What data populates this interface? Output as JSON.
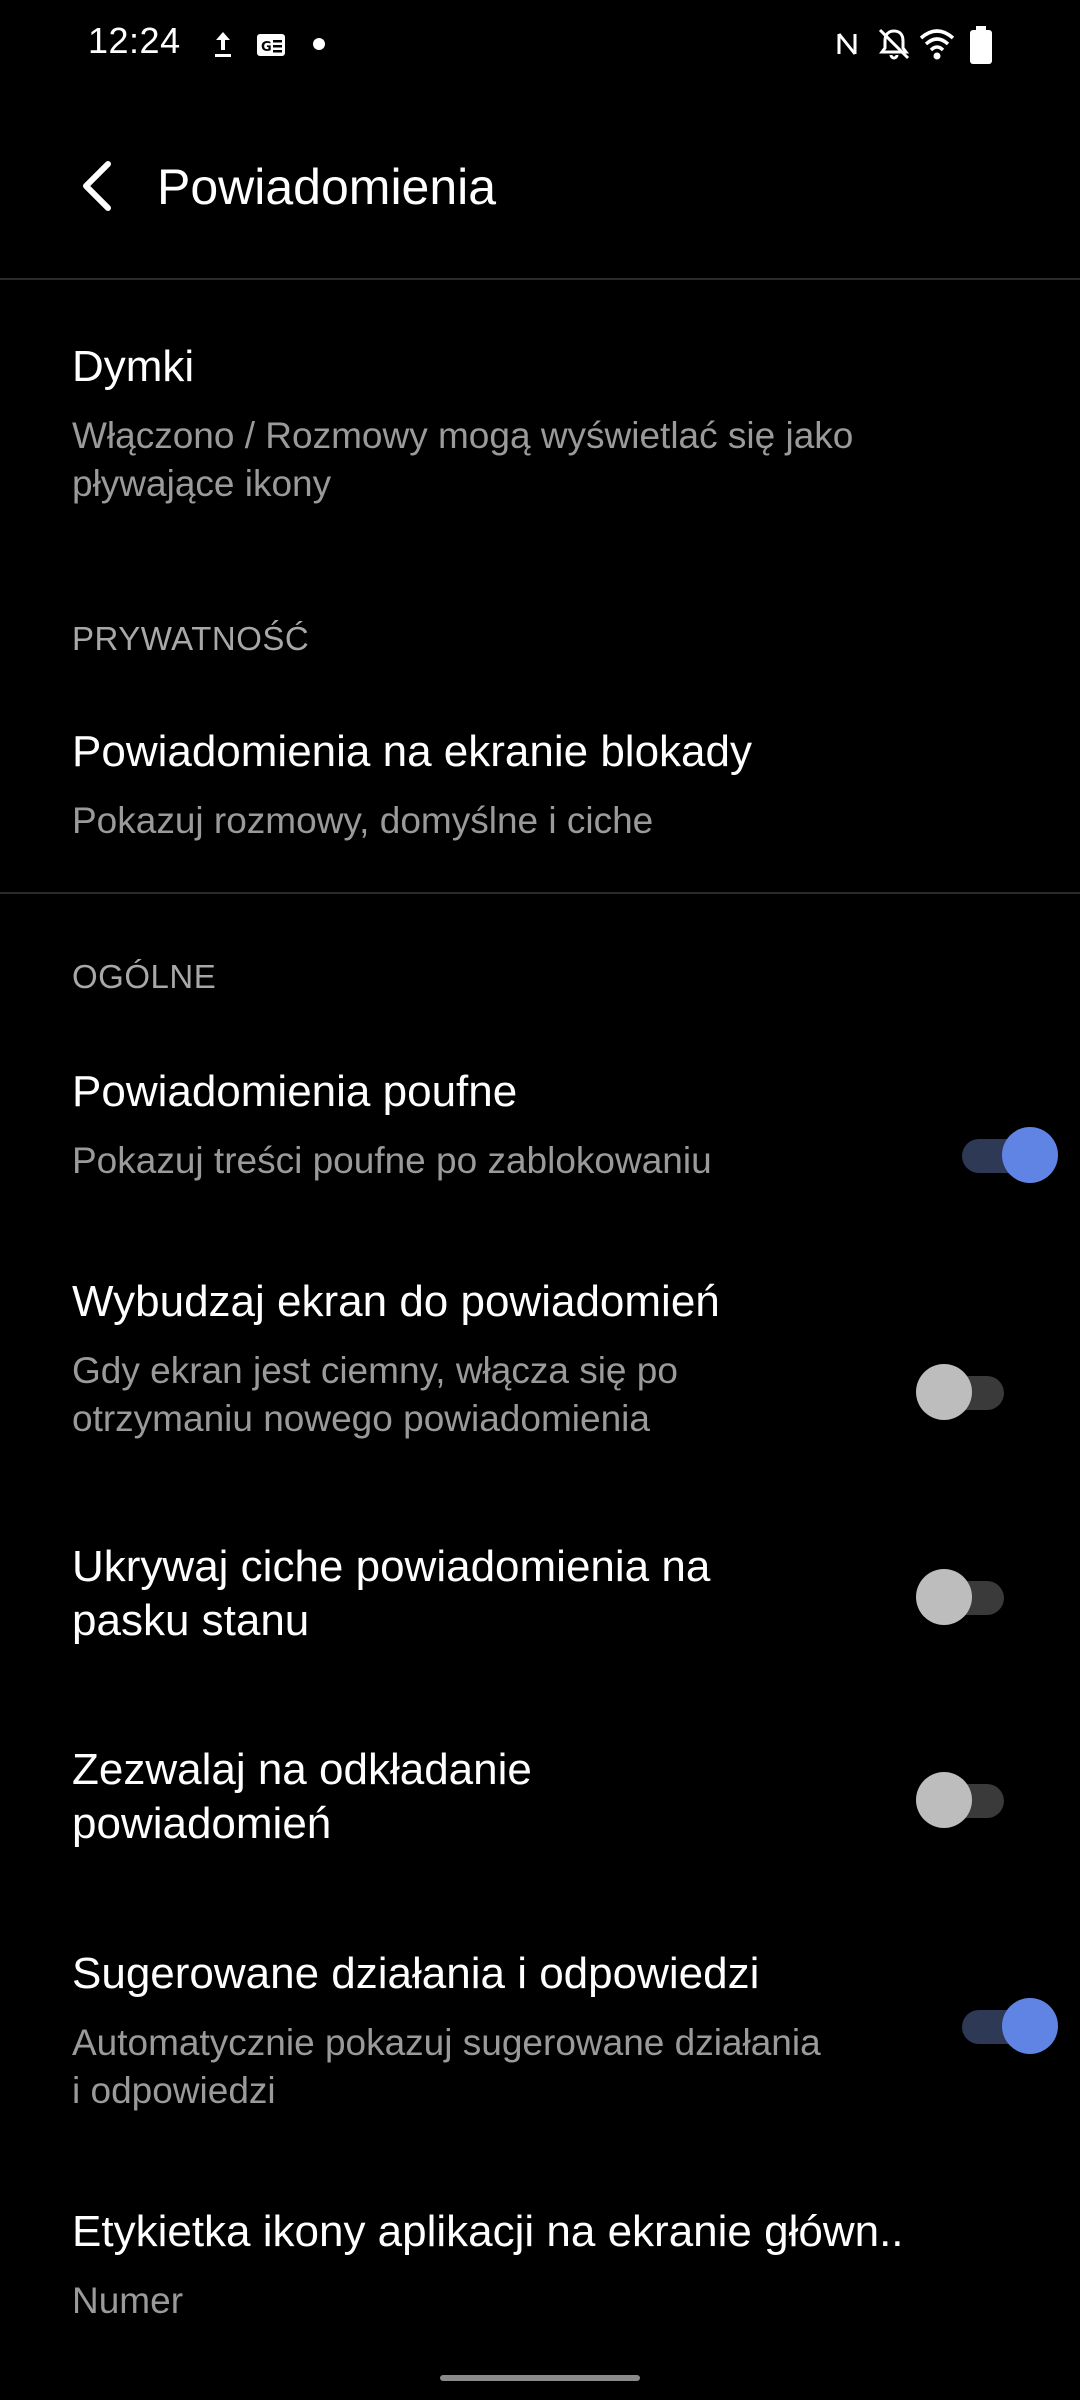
{
  "status_bar": {
    "time": "12:24",
    "left_icons": [
      "upload-icon",
      "news-icon",
      "dot-icon"
    ],
    "right_icons": [
      "nfc-icon",
      "bell-off-icon",
      "wifi-icon",
      "battery-icon"
    ]
  },
  "header": {
    "back_icon": "back-arrow-icon",
    "title": "Powiadomienia"
  },
  "items": [
    {
      "title": "Dymki",
      "subtitle": "Włączono / Rozmowy mogą wyświetlać się jako pływające ikony"
    },
    {
      "title": "Powiadomienia na ekranie blokady",
      "subtitle": "Pokazuj rozmowy, domyślne i ciche"
    },
    {
      "title": "Powiadomienia poufne",
      "subtitle": "Pokazuj treści poufne po zablokowaniu",
      "toggle": true
    },
    {
      "title": "Wybudzaj ekran do powiadomień",
      "subtitle": "Gdy ekran jest ciemny, włącza się po otrzymaniu nowego powiadomienia",
      "toggle": false
    },
    {
      "title": "Ukrywaj ciche powiadomienia na pasku stanu",
      "toggle": false
    },
    {
      "title": "Zezwalaj na odkładanie powiadomień",
      "toggle": false
    },
    {
      "title": "Sugerowane działania i odpowiedzi",
      "subtitle": "Automatycznie pokazuj sugerowane działania i odpowiedzi",
      "toggle": true
    },
    {
      "title": "Etykietka ikony aplikacji na ekranie główn..",
      "subtitle": "Numer"
    }
  ],
  "sections": {
    "privacy": "PRYWATNOŚĆ",
    "general": "OGÓLNE"
  },
  "colors": {
    "background": "#000000",
    "accent": "#5f84e4",
    "secondary_text": "#9a9a9a"
  }
}
